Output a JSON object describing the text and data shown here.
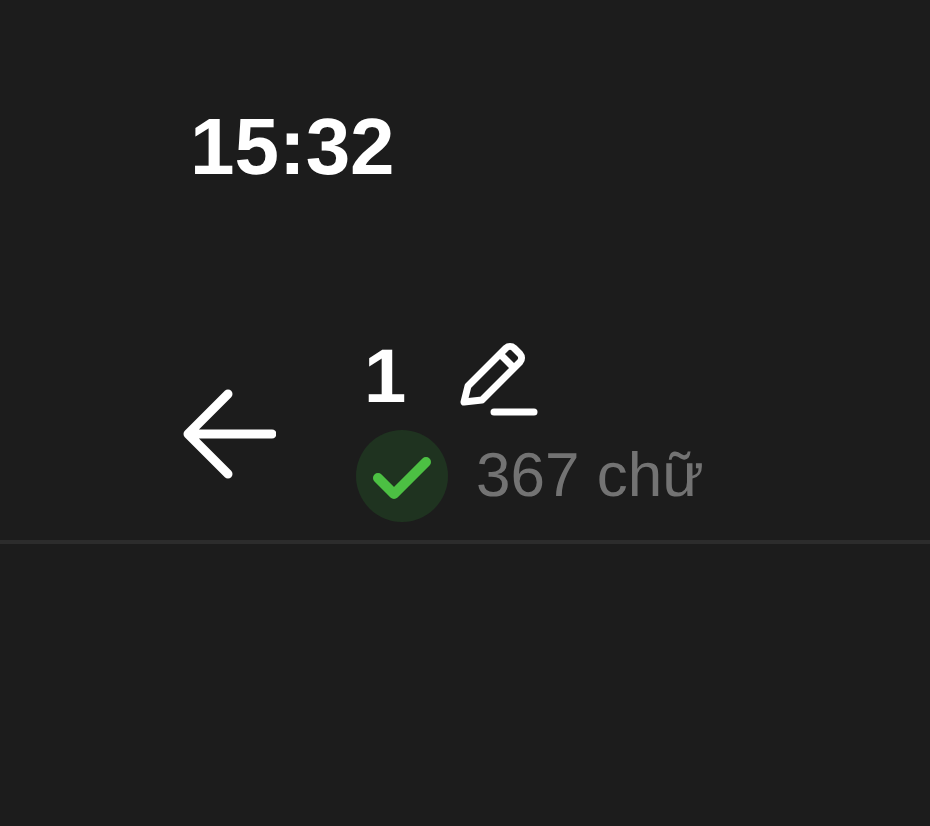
{
  "status_bar": {
    "time": "15:32"
  },
  "header": {
    "title": "1",
    "saved": true,
    "word_count": "367 chữ"
  }
}
